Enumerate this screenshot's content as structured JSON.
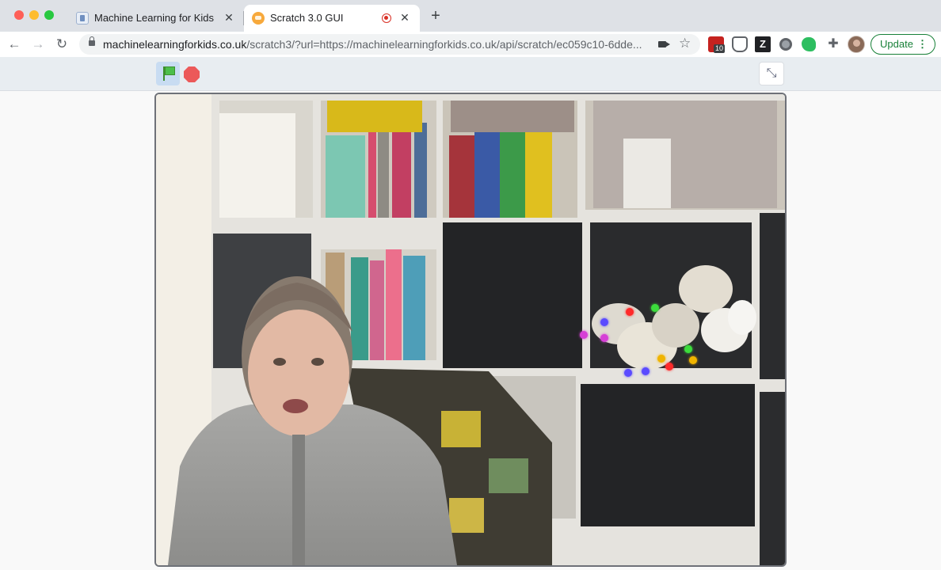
{
  "browser": {
    "tabs": [
      {
        "title": "Machine Learning for Kids",
        "active": false
      },
      {
        "title": "Scratch 3.0 GUI",
        "active": true,
        "recording": true
      }
    ],
    "address": {
      "domain": "machinelearningforkids.co.uk",
      "rest": "/scratch3/?url=https://machinelearningforkids.co.uk/api/scratch/ec059c10-6dde..."
    },
    "extension_badge": "10",
    "update_label": "Update"
  },
  "player": {
    "controls": [
      "green-flag",
      "stop",
      "exit-fullscreen"
    ]
  },
  "stage": {
    "content": "webcam",
    "tracking_dot_colors": [
      "#ff2a2a",
      "#3cdc3c",
      "#5b4bff",
      "#d640d6",
      "#f0b400"
    ]
  }
}
